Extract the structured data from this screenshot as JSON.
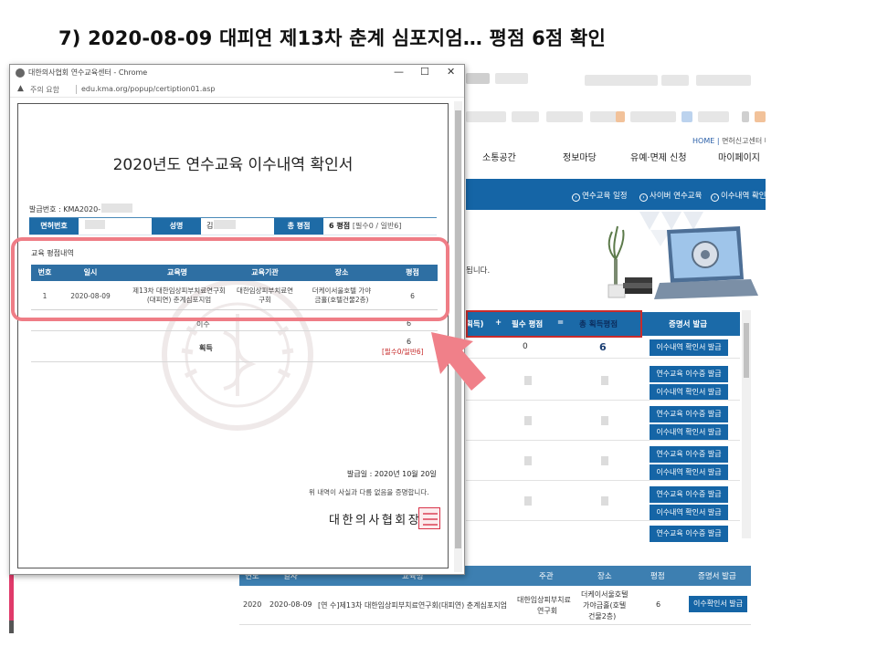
{
  "slide": {
    "title": "7) 2020-08-09 대피연 제13차 춘계 심포지엄…  평점 6점 확인"
  },
  "site": {
    "home": "HOME",
    "home_sub": "면허신고센터 바로",
    "menu": [
      "소통공간",
      "정보마당",
      "유예·면제 신청",
      "마이페이지"
    ],
    "blue_links": [
      "연수교육 일정",
      "사이버 연수교육",
      "이수내역 확인"
    ],
    "notice_tail": "됩니다.",
    "summary": {
      "head_1": "획득)",
      "plus": "+",
      "head_req": "필수 평점",
      "eq": "=",
      "head_total": "총 획득평점",
      "head_cert": "증명서 발급",
      "first_required": "0",
      "first_total": "6",
      "btn_history": "이수내역 확인서 발급",
      "btn_cert": "연수교육 이수증 발급",
      "btn_history_short": "이수내역 확인서 발급"
    },
    "bottom": {
      "headers": [
        "연도",
        "일자",
        "교육명",
        "주관",
        "장소",
        "평점",
        "증명서 발급"
      ],
      "row": {
        "year": "2020",
        "date": "2020-08-09",
        "name": "[연 수]제13차 대한임상피부치료연구회(대피연) 춘계심포지엄",
        "org_1": "대한임상피부치료",
        "org_2": "연구회",
        "place_1": "더케이서울호텔",
        "place_2": "가야금홀(호텔",
        "place_3": "건물2층)",
        "score": "6",
        "btn": "이수확인서 발급"
      }
    }
  },
  "popup": {
    "window_title": "대한의사협회 연수교육센터 - Chrome",
    "ctrl_min": "—",
    "ctrl_max": "☐",
    "ctrl_close": "✕",
    "security": "주의 요함",
    "url": "edu.kma.org/popup/certiption01.asp",
    "cert_title": "2020년도 연수교육 이수내역 확인서",
    "issue_no_label": "발급번호 : KMA2020-",
    "info": {
      "license_label": "면허번호",
      "name_label": "성명",
      "name_value": "김",
      "total_label": "총 평점",
      "total_value": "6 평점",
      "total_detail": "[필수0 / 일반6]"
    },
    "edu_section": "교육 평점내역",
    "edu_headers": [
      "번호",
      "일시",
      "교육명",
      "교육기관",
      "장소",
      "평점"
    ],
    "edu_row": {
      "no": "1",
      "date": "2020-08-09",
      "name_1": "제13차 대한임상피부치료연구회",
      "name_2": "(대피연) 춘계심포지엄",
      "org_1": "대한임상피부치료연",
      "org_2": "구회",
      "place_1": "더케이서울호텔 가야",
      "place_2": "금홀(호텔건물2층)",
      "score": "6"
    },
    "isu_label": "이수",
    "isu_value": "6",
    "get_label": "획득",
    "get_value": "6",
    "get_detail": "[필수0/일반6]",
    "issue_date": "발급일 : 2020년 10월 20일",
    "confirm": "위 내역이 사실과 다름 없음을 증명합니다.",
    "assoc": "대한의사협회장"
  },
  "colors": {
    "accent_blue": "#1565a6",
    "highlight_red": "#ef7d86",
    "seal_red": "#d9344a"
  }
}
